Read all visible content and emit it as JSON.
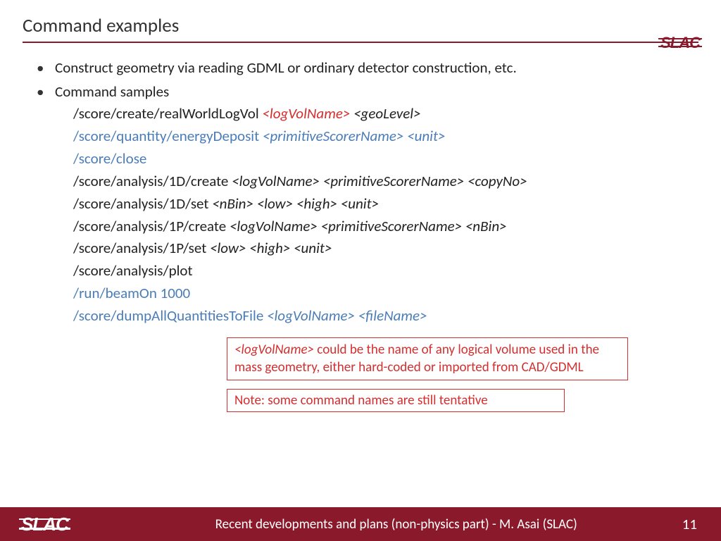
{
  "title": "Command examples",
  "bullets": {
    "b1": "Construct geometry via reading GDML or ordinary detector construction, etc.",
    "b2": "Command samples"
  },
  "cmds": {
    "c1a": "/score/create/realWorldLogVol ",
    "c1b": "<logVolName>",
    "c1c": " <geoLevel>",
    "c2a": "/score/quantity/energyDeposit ",
    "c2b": "<primitiveScorerName> <unit>",
    "c3": "/score/close",
    "c4a": "/score/analysis/1D/create ",
    "c4b": "<logVolName> <primitiveScorerName> <copyNo>",
    "c5a": "/score/analysis/1D/set ",
    "c5b": "<nBin> <low> <high> <unit>",
    "c6a": "/score/analysis/1P/create ",
    "c6b": "<logVolName> <primitiveScorerName> <nBin>",
    "c7a": "/score/analysis/1P/set ",
    "c7b": "<low> <high> <unit>",
    "c8": "/score/analysis/plot",
    "c9": "/run/beamOn 1000",
    "c10a": "/score/dumpAllQuantitiesToFile ",
    "c10b": "<logVolName> <fileName>"
  },
  "note1a": "<logVolName>",
  "note1b": " could be the name of any logical volume used in the mass geometry, either hard-coded or imported from CAD/GDML",
  "note2": "Note: some command names are still tentative",
  "footer": {
    "text": "Recent developments and plans (non-physics part) - M. Asai (SLAC)",
    "page": "11"
  },
  "logo": "SLAC"
}
